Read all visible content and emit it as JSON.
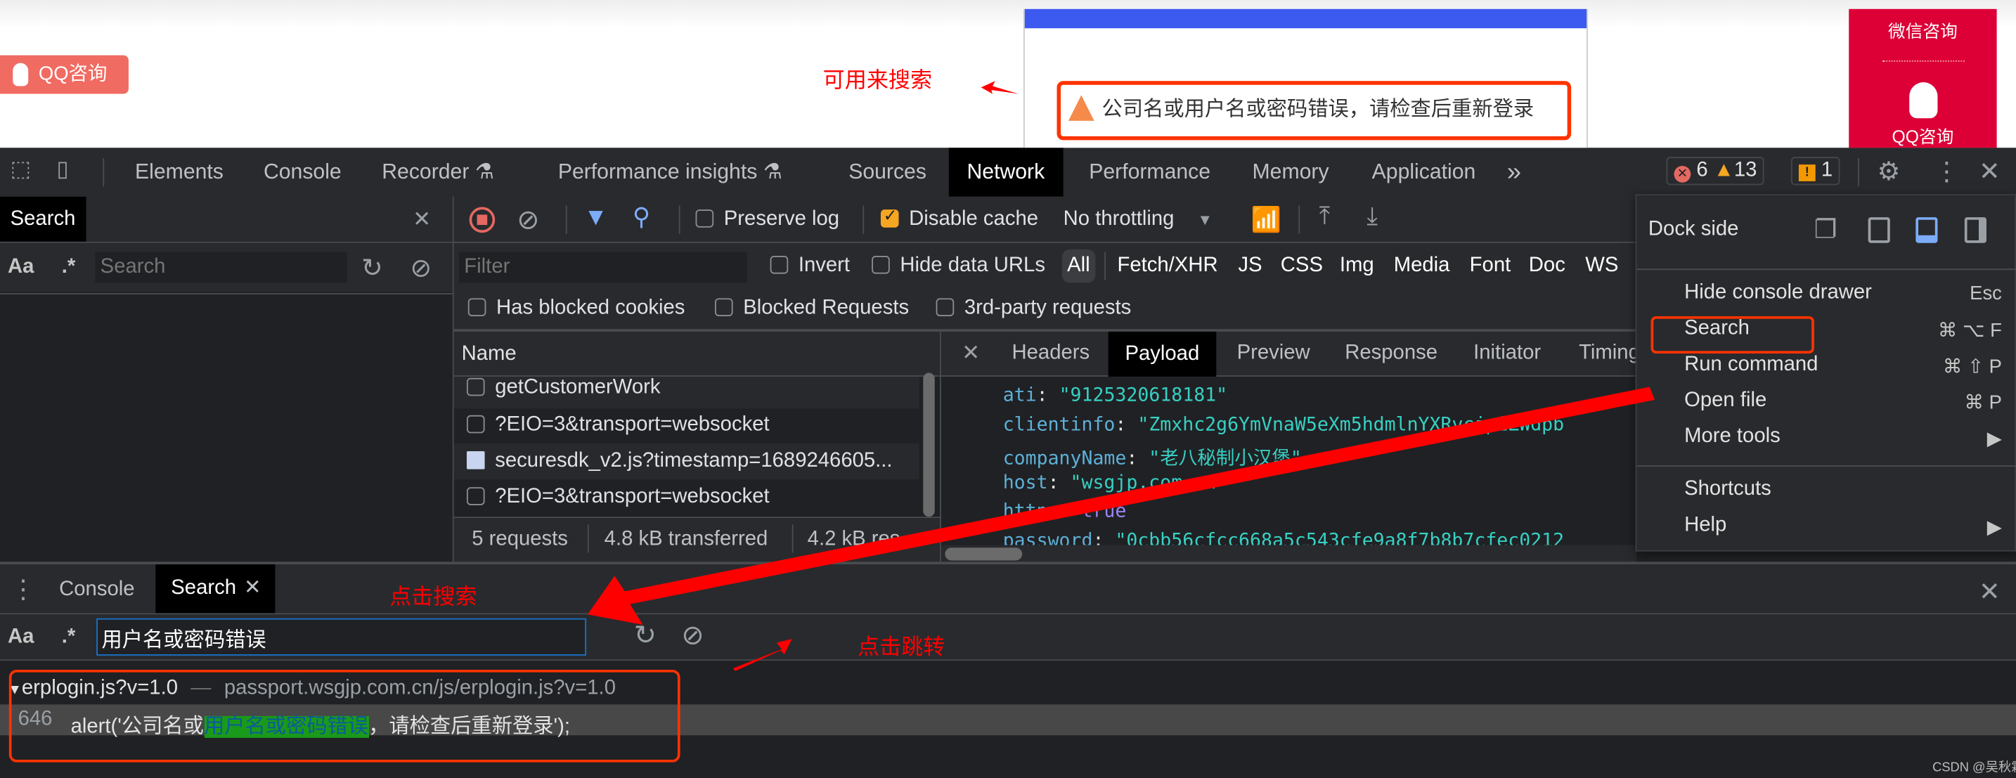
{
  "web": {
    "qq_button": "QQ咨询",
    "annotation_search": "可用来搜索",
    "alert_text": "公司名或用户名或密码错误，请检查后重新登录",
    "side_wechat": "微信咨询",
    "side_qq": "QQ咨询",
    "colors": {
      "login_bar": "#3c5af0",
      "side_panel": "#dc0037",
      "qq_button": "#f06b62"
    }
  },
  "devtools": {
    "tabs": [
      "Elements",
      "Console",
      "Recorder",
      "Performance insights",
      "Sources",
      "Network",
      "Performance",
      "Memory",
      "Application"
    ],
    "active_tab": "Network",
    "more_tabs": "»",
    "badges": {
      "errors": "6",
      "warnings": "13",
      "issues": "1"
    }
  },
  "left_search": {
    "tab": "Search",
    "aa": "Aa",
    "regex": ".*",
    "placeholder": "Search"
  },
  "network": {
    "preserve_log": "Preserve log",
    "disable_cache": "Disable cache",
    "throttling": "No throttling",
    "filter_placeholder": "Filter",
    "invert": "Invert",
    "hide_data_urls": "Hide data URLs",
    "types": [
      "All",
      "Fetch/XHR",
      "JS",
      "CSS",
      "Img",
      "Media",
      "Font",
      "Doc",
      "WS"
    ],
    "has_blocked_cookies": "Has blocked cookies",
    "blocked_requests": "Blocked Requests",
    "third_party": "3rd-party requests",
    "name_header": "Name",
    "requests": [
      "getCustomerWork",
      "?EIO=3&transport=websocket",
      "securesdk_v2.js?timestamp=1689246605...",
      "?EIO=3&transport=websocket"
    ],
    "status": {
      "requests": "5 requests",
      "transferred": "4.8 kB transferred",
      "resources": "4.2 kB res"
    }
  },
  "detail": {
    "tabs": [
      "Headers",
      "Payload",
      "Preview",
      "Response",
      "Initiator",
      "Timing"
    ],
    "active_tab": "Payload",
    "payload": [
      {
        "key": "ati",
        "value": "\"9125320618181\"",
        "type": "str"
      },
      {
        "key": "clientinfo",
        "value": "\"Zmxhc2g6YmVnaW5eXm5hdmlnYXRvcjpiZWdpb",
        "type": "str"
      },
      {
        "key": "companyName",
        "value": "\"老八秘制小汉堡\"",
        "type": "str"
      },
      {
        "key": "host",
        "value": "\"wsgjp.com.cn\"",
        "type": "str"
      },
      {
        "key": "https",
        "value": "true",
        "type": "bool"
      },
      {
        "key": "password",
        "value": "\"0cbb56cfcc668a5c543cfe9a8f7b8b7cfec0212",
        "type": "str"
      }
    ]
  },
  "menu": {
    "dock_side": "Dock side",
    "items": [
      {
        "label": "Hide console drawer",
        "shortcut": "Esc"
      },
      {
        "label": "Search",
        "shortcut": "⌘ ⌥ F"
      },
      {
        "label": "Run command",
        "shortcut": "⌘ ⇧ P"
      },
      {
        "label": "Open file",
        "shortcut": "⌘ P"
      },
      {
        "label": "More tools",
        "shortcut": "▶"
      }
    ],
    "items2": [
      {
        "label": "Shortcuts",
        "shortcut": ""
      },
      {
        "label": "Help",
        "shortcut": "▶"
      }
    ]
  },
  "drawer": {
    "tabs": [
      "Console",
      "Search"
    ],
    "annotation_click_search": "点击搜索",
    "annotation_click_jump": "点击跳转",
    "aa": "Aa",
    "regex": ".*",
    "query": "用户名或密码错误",
    "result_file": "erplogin.js?v=1.0",
    "result_sep": "—",
    "result_url": "passport.wsgjp.com.cn/js/erplogin.js?v=1.0",
    "result_line": "646",
    "result_pre": "alert('公司名或",
    "result_match": "用户名或密码错误",
    "result_post": "，请检查后重新登录');"
  },
  "watermark": "CSDN @吴秋霖"
}
